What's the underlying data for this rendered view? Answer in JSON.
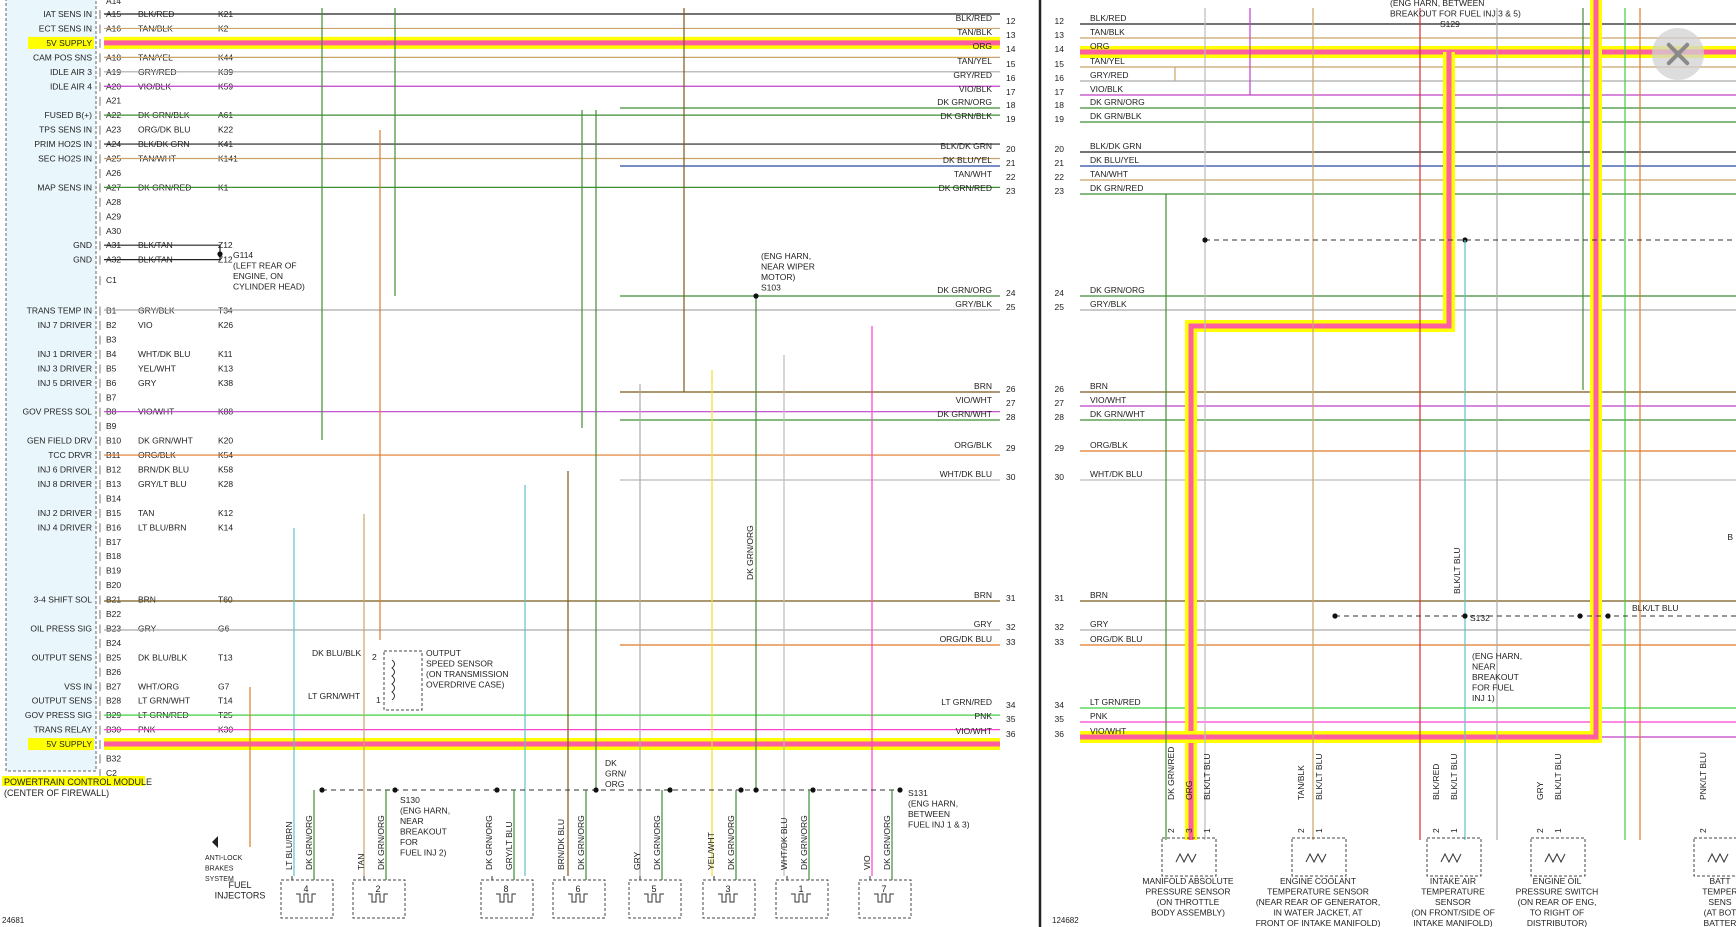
{
  "pcm_pins": [
    {
      "pin": "A15",
      "label": "IAT SENS IN",
      "color": "BLK/RED",
      "circuit": "K21"
    },
    {
      "pin": "A16",
      "label": "ECT SENS IN",
      "color": "TAN/BLK",
      "circuit": "K2"
    },
    {
      "pin": "A17",
      "label": "5V SUPPLY",
      "color": "ORG",
      "circuit": "K7"
    },
    {
      "pin": "A18",
      "label": "CAM POS SNS",
      "color": "TAN/YEL",
      "circuit": "K44"
    },
    {
      "pin": "A19",
      "label": "IDLE AIR 3",
      "color": "GRY/RED",
      "circuit": "K39"
    },
    {
      "pin": "A20",
      "label": "IDLE AIR 4",
      "color": "VIO/BLK",
      "circuit": "K59"
    },
    {
      "pin": "A21",
      "label": "",
      "color": "",
      "circuit": ""
    },
    {
      "pin": "A22",
      "label": "FUSED B(+)",
      "color": "DK GRN/BLK",
      "circuit": "A61"
    },
    {
      "pin": "A23",
      "label": "TPS SENS IN",
      "color": "ORG/DK BLU",
      "circuit": "K22"
    },
    {
      "pin": "A24",
      "label": "PRIM HO2S IN",
      "color": "BLK/DK GRN",
      "circuit": "K41"
    },
    {
      "pin": "A25",
      "label": "SEC HO2S IN",
      "color": "TAN/WHT",
      "circuit": "K141"
    },
    {
      "pin": "A26",
      "label": "",
      "color": "",
      "circuit": ""
    },
    {
      "pin": "A27",
      "label": "MAP SENS IN",
      "color": "DK GRN/RED",
      "circuit": "K1"
    },
    {
      "pin": "A28",
      "label": "",
      "color": "",
      "circuit": ""
    },
    {
      "pin": "A29",
      "label": "",
      "color": "",
      "circuit": ""
    },
    {
      "pin": "A30",
      "label": "",
      "color": "",
      "circuit": ""
    },
    {
      "pin": "A31",
      "label": "GND",
      "color": "BLK/TAN",
      "circuit": "Z12"
    },
    {
      "pin": "A32",
      "label": "GND",
      "color": "BLK/TAN",
      "circuit": "Z12"
    },
    {
      "pin": "C1",
      "label": "",
      "color": "",
      "circuit": ""
    },
    {
      "pin": "B1",
      "label": "TRANS TEMP IN",
      "color": "GRY/BLK",
      "circuit": "T34"
    },
    {
      "pin": "B2",
      "label": "INJ 7 DRIVER",
      "color": "VIO",
      "circuit": "K26"
    },
    {
      "pin": "B3",
      "label": "",
      "color": "",
      "circuit": ""
    },
    {
      "pin": "B4",
      "label": "INJ 1 DRIVER",
      "color": "WHT/DK BLU",
      "circuit": "K11"
    },
    {
      "pin": "B5",
      "label": "INJ 3 DRIVER",
      "color": "YEL/WHT",
      "circuit": "K13"
    },
    {
      "pin": "B6",
      "label": "INJ 5 DRIVER",
      "color": "GRY",
      "circuit": "K38"
    },
    {
      "pin": "B7",
      "label": "",
      "color": "",
      "circuit": ""
    },
    {
      "pin": "B8",
      "label": "GOV PRESS SOL",
      "color": "VIO/WHT",
      "circuit": "K88"
    },
    {
      "pin": "B9",
      "label": "",
      "color": "",
      "circuit": ""
    },
    {
      "pin": "B10",
      "label": "GEN FIELD DRV",
      "color": "DK GRN/WHT",
      "circuit": "K20"
    },
    {
      "pin": "B11",
      "label": "TCC DRVR",
      "color": "ORG/BLK",
      "circuit": "K54"
    },
    {
      "pin": "B12",
      "label": "INJ 6 DRIVER",
      "color": "BRN/DK BLU",
      "circuit": "K58"
    },
    {
      "pin": "B13",
      "label": "INJ 8 DRIVER",
      "color": "GRY/LT BLU",
      "circuit": "K28"
    },
    {
      "pin": "B14",
      "label": "",
      "color": "",
      "circuit": ""
    },
    {
      "pin": "B15",
      "label": "INJ 2 DRIVER",
      "color": "TAN",
      "circuit": "K12"
    },
    {
      "pin": "B16",
      "label": "INJ 4 DRIVER",
      "color": "LT BLU/BRN",
      "circuit": "K14"
    },
    {
      "pin": "B17",
      "label": "",
      "color": "",
      "circuit": ""
    },
    {
      "pin": "B18",
      "label": "",
      "color": "",
      "circuit": ""
    },
    {
      "pin": "B19",
      "label": "",
      "color": "",
      "circuit": ""
    },
    {
      "pin": "B20",
      "label": "",
      "color": "",
      "circuit": ""
    },
    {
      "pin": "B21",
      "label": "3-4 SHIFT SOL",
      "color": "BRN",
      "circuit": "T60"
    },
    {
      "pin": "B22",
      "label": "",
      "color": "",
      "circuit": ""
    },
    {
      "pin": "B23",
      "label": "OIL PRESS SIG",
      "color": "GRY",
      "circuit": "G6"
    },
    {
      "pin": "B24",
      "label": "",
      "color": "",
      "circuit": ""
    },
    {
      "pin": "B25",
      "label": "OUTPUT SENS",
      "color": "DK BLU/BLK",
      "circuit": "T13"
    },
    {
      "pin": "B26",
      "label": "",
      "color": "",
      "circuit": ""
    },
    {
      "pin": "B27",
      "label": "VSS IN",
      "color": "WHT/ORG",
      "circuit": "G7"
    },
    {
      "pin": "B28",
      "label": "OUTPUT SENS",
      "color": "LT GRN/WHT",
      "circuit": "T14"
    },
    {
      "pin": "B29",
      "label": "GOV PRESS SIG",
      "color": "LT GRN/RED",
      "circuit": "T25"
    },
    {
      "pin": "B30",
      "label": "TRANS RELAY",
      "color": "PNK",
      "circuit": "K30"
    },
    {
      "pin": "B31",
      "label": "5V SUPPLY",
      "color": "VIO/WHT",
      "circuit": "K6"
    },
    {
      "pin": "B32",
      "label": "",
      "color": "",
      "circuit": ""
    },
    {
      "pin": "C2",
      "label": "",
      "color": "",
      "circuit": ""
    }
  ],
  "top_pin_partial": "A14",
  "pcm_title": "POWERTRAIN CONTROL MODULE",
  "pcm_subtitle": "(CENTER OF FIREWALL)",
  "ground_g114": [
    "G114",
    "(LEFT REAR OF",
    "ENGINE, ON",
    "CYLINDER HEAD)"
  ],
  "connector_rows": [
    {
      "num": "12",
      "color": "BLK/RED",
      "left_label": "BLK/RED"
    },
    {
      "num": "13",
      "color": "TAN/BLK",
      "left_label": "TAN/BLK"
    },
    {
      "num": "14",
      "color": "ORG",
      "left_label": "ORG"
    },
    {
      "num": "15",
      "color": "TAN/YEL",
      "left_label": "TAN/YEL"
    },
    {
      "num": "16",
      "color": "GRY/RED",
      "left_label": "GRY/RED"
    },
    {
      "num": "17",
      "color": "VIO/BLK",
      "left_label": "VIO/BLK"
    },
    {
      "num": "18",
      "color": "DK GRN/ORG",
      "left_label": "DK GRN/ORG"
    },
    {
      "num": "19",
      "color": "DK GRN/BLK",
      "left_label": "DK GRN/BLK"
    },
    {
      "num": "20",
      "color": "BLK/DK GRN",
      "left_label": "BLK/DK GRN"
    },
    {
      "num": "21",
      "color": "DK BLU/YEL",
      "left_label": "DK BLU/YEL"
    },
    {
      "num": "22",
      "color": "TAN/WHT",
      "left_label": "TAN/WHT"
    },
    {
      "num": "23",
      "color": "DK GRN/RED",
      "left_label": "DK GRN/RED"
    },
    {
      "num": "24",
      "color": "DK GRN/ORG",
      "left_label": "DK GRN/ORG"
    },
    {
      "num": "25",
      "color": "GRY/BLK",
      "left_label": "GRY/BLK"
    },
    {
      "num": "26",
      "color": "BRN",
      "left_label": "BRN"
    },
    {
      "num": "27",
      "color": "VIO/WHT",
      "left_label": "VIO/WHT"
    },
    {
      "num": "28",
      "color": "DK GRN/WHT",
      "left_label": "DK GRN/WHT"
    },
    {
      "num": "29",
      "color": "ORG/BLK",
      "left_label": "ORG/BLK"
    },
    {
      "num": "30",
      "color": "WHT/DK BLU",
      "left_label": "WHT/DK BLU"
    },
    {
      "num": "31",
      "color": "BRN",
      "left_label": "BRN"
    },
    {
      "num": "32",
      "color": "GRY",
      "left_label": "GRY"
    },
    {
      "num": "33",
      "color": "ORG/DK BLU",
      "left_label": "ORG/DK BLU"
    },
    {
      "num": "34",
      "color": "LT GRN/RED",
      "left_label": "LT GRN/RED"
    },
    {
      "num": "35",
      "color": "PNK",
      "left_label": "PNK"
    },
    {
      "num": "36",
      "color": "VIO/WHT",
      "left_label": "VIO/WHT"
    }
  ],
  "splice_s103": [
    "(ENG HARN,",
    "NEAR WIPER",
    "MOTOR)",
    "S103"
  ],
  "splice_s130": [
    "S130",
    "(ENG HARN,",
    "NEAR",
    "BREAKOUT",
    "FOR",
    "FUEL INJ 2)"
  ],
  "splice_s131": [
    "S131",
    "(ENG HARN,",
    "BETWEEN",
    "FUEL INJ 1 & 3)"
  ],
  "splice_s129": [
    "(ENG HARN, BETWEEN",
    "BREAKOUT FOR FUEL INJ 3 & 5)",
    "S129"
  ],
  "splice_s132": [
    "S132",
    "(ENG HARN,",
    "NEAR",
    "BREAKOUT",
    "FOR FUEL",
    "INJ 1)"
  ],
  "output_speed_sensor": [
    "OUTPUT",
    "SPEED SENSOR",
    "(ON TRANSMISSION",
    "OVERDRIVE CASE)"
  ],
  "oss_wire_1": "DK BLU/BLK",
  "oss_wire_2": "LT GRN/WHT",
  "anti_lock": [
    "ANTI-LOCK",
    "BRAKES",
    "SYSTEM"
  ],
  "fuel_injectors_label": [
    "FUEL",
    "INJECTORS"
  ],
  "injectors": [
    {
      "num": "4",
      "w1": "LT BLU/BRN",
      "w2": "DK GRN/ORG"
    },
    {
      "num": "2",
      "w1": "TAN",
      "w2": "DK GRN/ORG"
    },
    {
      "num": "8",
      "w1": "DK GRN/ORG",
      "w2": "GRY/LT BLU"
    },
    {
      "num": "6",
      "w1": "BRN/DK BLU",
      "w2": "DK GRN/ORG"
    },
    {
      "num": "5",
      "w1": "GRY",
      "w2": "DK GRN/ORG"
    },
    {
      "num": "3",
      "w1": "YEL/WHT",
      "w2": "DK GRN/ORG"
    },
    {
      "num": "1",
      "w1": "WHT/DK BLU",
      "w2": "DK GRN/ORG"
    },
    {
      "num": "7",
      "w1": "VIO",
      "w2": "DK GRN/ORG"
    }
  ],
  "vertical_labels": {
    "dk_grn_org_mid": "DK GRN/ORG",
    "dk_grn_org_split": "DK GRN/ ORG",
    "blk_lt_blu_1": "BLK/LT BLU",
    "blk_lt_blu_2": "BLK/LT BLU"
  },
  "s132_wire_label": "BLK/LT BLU",
  "sensors": [
    {
      "name": [
        "MANIFOLD ABSOLUTE",
        "PRESSURE SENSOR",
        "(ON THROTTLE",
        "BODY ASSEMBLY)"
      ],
      "wires": [
        "DK GRN/RED",
        "ORG",
        "BLK/LT BLU"
      ],
      "pins": [
        "2",
        "3",
        "1"
      ]
    },
    {
      "name": [
        "ENGINE COOLANT",
        "TEMPERATURE SENSOR",
        "(NEAR REAR OF GENERATOR,",
        "IN WATER JACKET, AT",
        "FRONT OF INTAKE MANIFOLD)"
      ],
      "wires": [
        "TAN/BLK",
        "BLK/LT BLU"
      ],
      "pins": [
        "2",
        "1"
      ]
    },
    {
      "name": [
        "INTAKE AIR",
        "TEMPERATURE",
        "SENSOR",
        "(ON FRONT/SIDE OF",
        "INTAKE MANIFOLD)"
      ],
      "wires": [
        "BLK/RED",
        "BLK/LT BLU"
      ],
      "pins": [
        "2",
        "1"
      ]
    },
    {
      "name": [
        "ENGINE OIL",
        "PRESSURE SWITCH",
        "(ON REAR OF ENG,",
        "TO RIGHT OF",
        "DISTRIBUTOR)"
      ],
      "wires": [
        "GRY",
        "BLK/LT BLU"
      ],
      "pins": [
        "2",
        "1"
      ]
    },
    {
      "name": [
        "BATT",
        "TEMPER",
        "SENS",
        "(AT BOT",
        "BATTER"
      ],
      "wires": [
        "PNK/LT BLU"
      ],
      "pins": [
        "2"
      ]
    }
  ],
  "partial_right_letter": "B",
  "page_left_id": "24681",
  "page_right_id": "124682",
  "colors": {
    "highlight_yellow": "#ffff00",
    "highlight_pink": "#ff5fa0",
    "pcm_fill": "#e9f6fc",
    "divider": "#222222"
  },
  "icons": [
    "close-icon"
  ]
}
